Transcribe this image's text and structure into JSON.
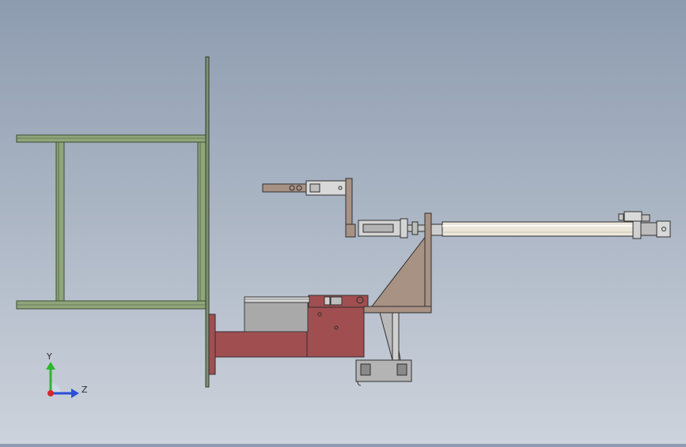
{
  "viewport": {
    "background_top": "#8e9cb0",
    "background_bottom": "#cdd3dc"
  },
  "colors": {
    "frame": "#8fa67a",
    "frame_edge": "#3e4b34",
    "mount_plate": "#7f9170",
    "cylinder_body": "#a14e50",
    "bracket": "#a89284",
    "rod": "#e8e2d6",
    "steel": "#a9a9a9",
    "outline": "#2f2f2f"
  },
  "triad": {
    "y_label": "Y",
    "z_label": "Z",
    "y_color": "#2fb52f",
    "z_color": "#2b4fd6",
    "x_color": "#d42a2a"
  }
}
